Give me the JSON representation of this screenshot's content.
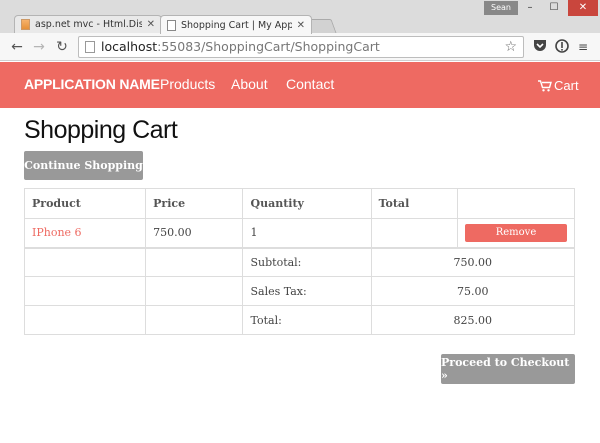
{
  "browser": {
    "tabs": [
      {
        "title": "asp.net mvc - Html.Displa",
        "active": false
      },
      {
        "title": "Shopping Cart | My Applic",
        "active": true
      }
    ],
    "user": "Sean",
    "address": {
      "host": "localhost",
      "path": ":55083/ShoppingCart/ShoppingCart"
    },
    "icons": [
      "back-arrow",
      "forward-arrow",
      "reload",
      "star",
      "pocket",
      "extension",
      "menu"
    ]
  },
  "navbar": {
    "brand": "APPLICATION NAME",
    "links": [
      "Products",
      "About",
      "Contact"
    ],
    "cart_label": "Cart",
    "color": "#ee6a62"
  },
  "page": {
    "title": "Shopping Cart",
    "continue_label": "Continue Shopping",
    "checkout_label": "Proceed to Checkout »"
  },
  "cart": {
    "headers": [
      "Product",
      "Price",
      "Quantity",
      "Total",
      ""
    ],
    "items": [
      {
        "product": "IPhone 6",
        "price": "750.00",
        "quantity": "1",
        "total": "",
        "action": "Remove"
      }
    ],
    "summary": [
      {
        "label": "Subtotal:",
        "value": "750.00"
      },
      {
        "label": "Sales Tax:",
        "value": "75.00"
      },
      {
        "label": "Total:",
        "value": "825.00"
      }
    ]
  }
}
